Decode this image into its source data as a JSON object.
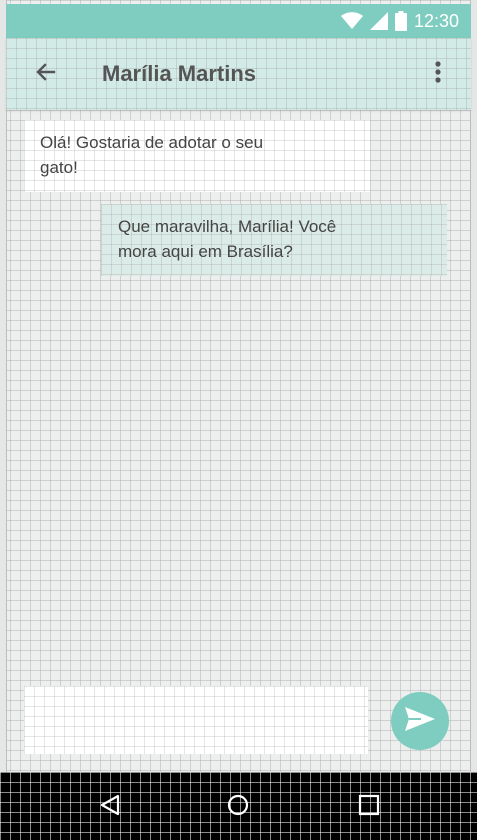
{
  "status_bar": {
    "time": "12:30",
    "icons": [
      "wifi-icon",
      "cell-signal-icon",
      "battery-icon"
    ],
    "color": "#7ecdc0"
  },
  "app_bar": {
    "title": "Marília Martins",
    "back_icon": "arrow-left-icon",
    "menu_icon": "more-vertical-icon",
    "color": "#d3ebe6"
  },
  "messages": [
    {
      "direction": "incoming",
      "text": "Olá! Gostaria de adotar o seu gato!"
    },
    {
      "direction": "outgoing",
      "text": "Que maravilha, Marília! Você mora aqui em Brasília?"
    }
  ],
  "composer": {
    "value": "",
    "placeholder": "",
    "send_icon": "send-icon",
    "accent": "#7ecdc0"
  },
  "nav_bar": {
    "icons": [
      "nav-back-icon",
      "nav-home-icon",
      "nav-recents-icon"
    ]
  }
}
